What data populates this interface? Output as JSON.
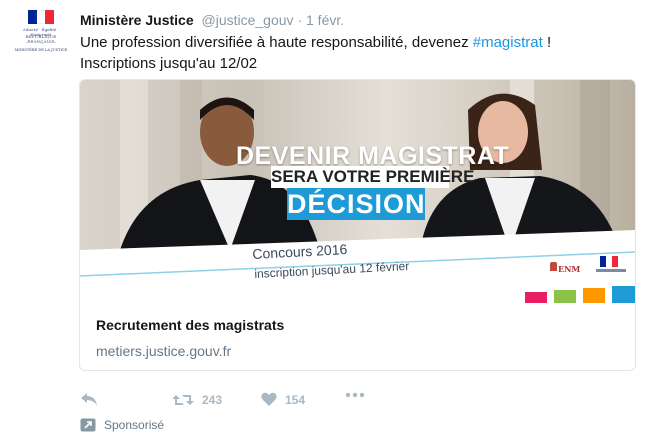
{
  "tweet": {
    "author_name": "Ministère Justice",
    "handle": "@justice_gouv",
    "separator": "·",
    "date": "1 févr.",
    "text_before": "Une profession diversifiée à haute responsabilité, devenez ",
    "hashtag": "#magistrat",
    "text_after": " !",
    "text_line2": "Inscriptions jusqu'au 12/02"
  },
  "avatar": {
    "motto": "Liberté · Égalité · Fraternité",
    "republic": "RÉPUBLIQUE FRANÇAISE",
    "ministry": "MINISTÈRE DE LA JUSTICE",
    "flag_colors": [
      "#002395",
      "#ffffff",
      "#ed2939"
    ]
  },
  "card": {
    "banner_line1": "DEVENIR MAGISTRAT",
    "banner_line2": "SERA VOTRE PREMIÈRE",
    "banner_line3": "DÉCISION",
    "concours": "Concours 2016",
    "inscription": "inscription jusqu'au 12 février",
    "school_logo": "ENM",
    "title": "Recrutement des magistrats",
    "url": "metiers.justice.gouv.fr",
    "accent_color": "#1e9ad6",
    "color_bars": [
      "#e91e63",
      "#8bc34a",
      "#ffc107",
      "#ff9800",
      "#1e9ad6"
    ]
  },
  "actions": {
    "reply_icon": "reply-icon",
    "retweet_icon": "retweet-icon",
    "retweet_count": "243",
    "like_icon": "heart-icon",
    "like_count": "154",
    "more_icon": "more-icon"
  },
  "promoted": {
    "label": "Sponsorisé",
    "icon": "promoted-arrow-icon"
  }
}
